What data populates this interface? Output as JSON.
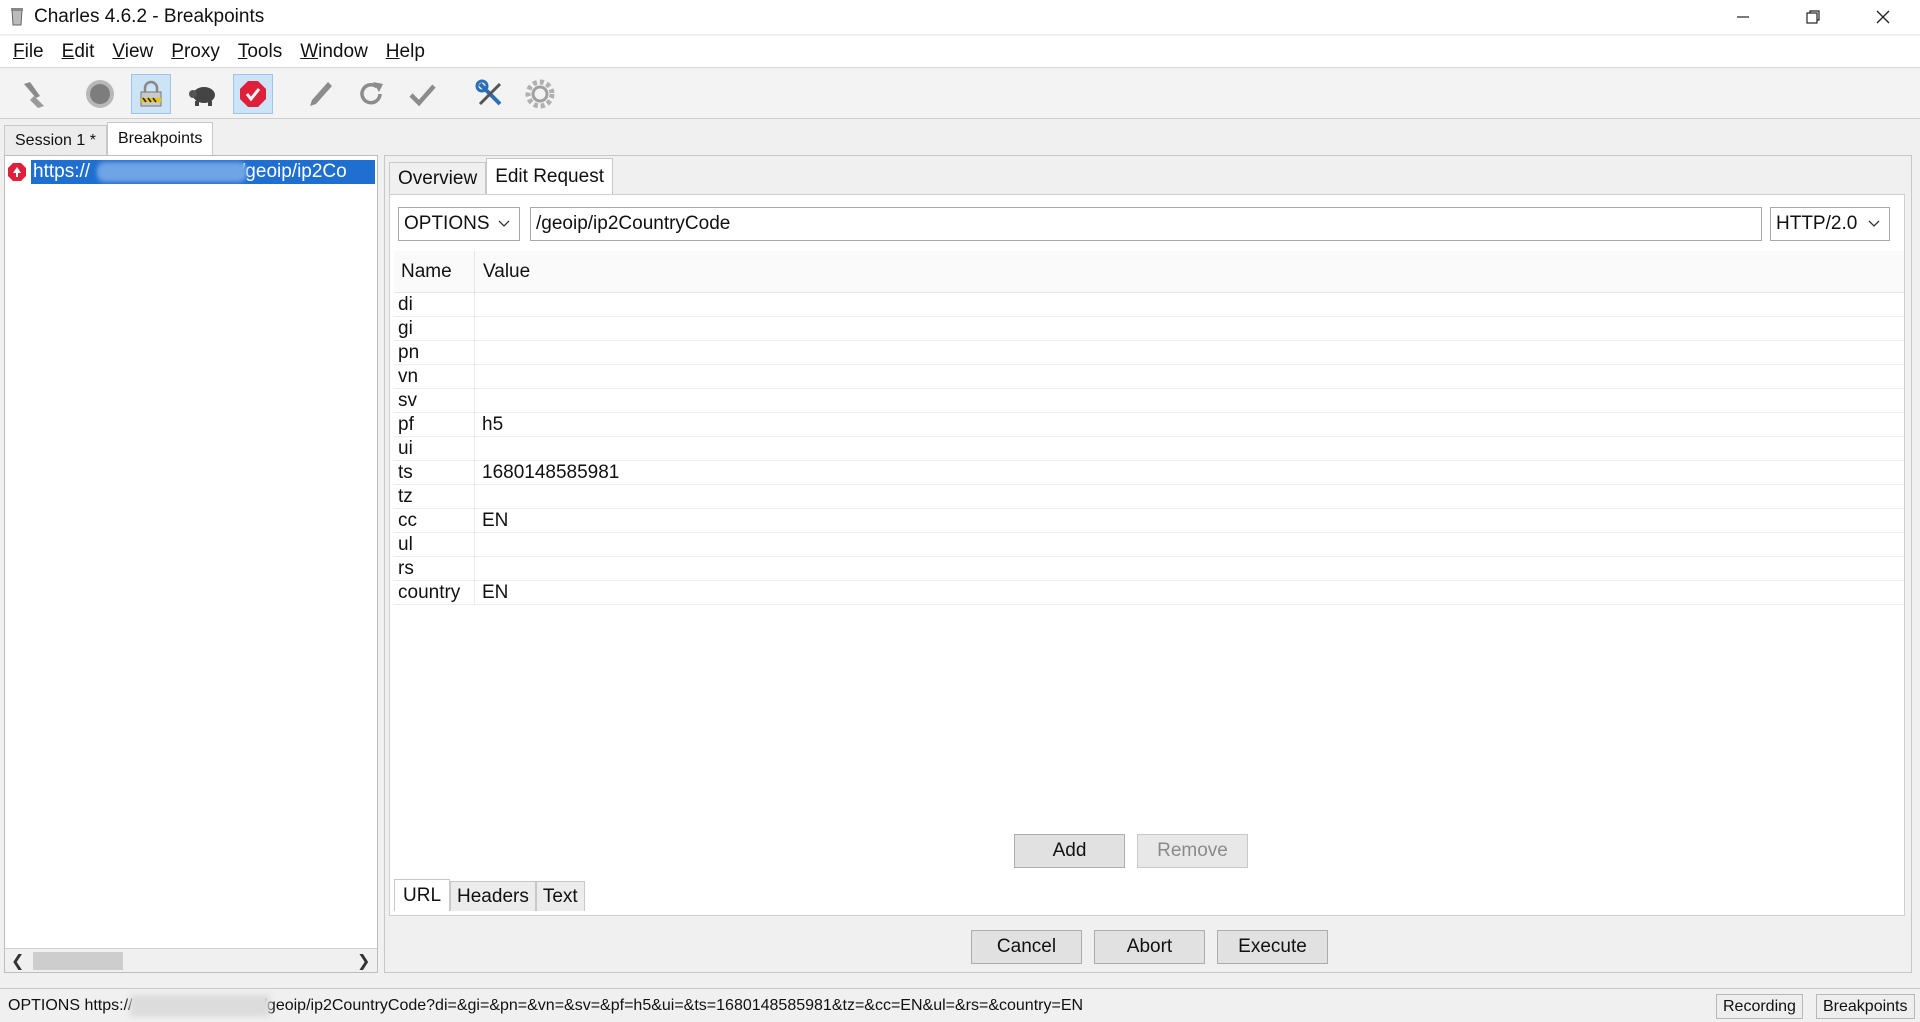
{
  "window": {
    "title": "Charles 4.6.2 - Breakpoints"
  },
  "menu": [
    {
      "label": "File",
      "u": "F",
      "rest": "ile"
    },
    {
      "label": "Edit",
      "u": "E",
      "rest": "dit"
    },
    {
      "label": "View",
      "u": "V",
      "rest": "iew"
    },
    {
      "label": "Proxy",
      "u": "P",
      "rest": "roxy"
    },
    {
      "label": "Tools",
      "u": "T",
      "rest": "ools"
    },
    {
      "label": "Window",
      "u": "W",
      "rest": "indow"
    },
    {
      "label": "Help",
      "u": "H",
      "rest": "elp"
    }
  ],
  "toolbar": {
    "icons": [
      "broom-icon",
      "record-icon",
      "ssl-proxy-icon",
      "throttle-icon",
      "breakpoints-icon",
      "pen-icon",
      "refresh-icon",
      "check-icon",
      "tools-icon",
      "settings-icon"
    ],
    "active": [
      "ssl-proxy-icon",
      "breakpoints-icon"
    ]
  },
  "session_tabs": [
    "Session 1 *",
    "Breakpoints"
  ],
  "tree": {
    "url_prefix": "https://",
    "url_suffix": "/geoip/ip2Co"
  },
  "right_tabs": [
    "Overview",
    "Edit Request"
  ],
  "request": {
    "method": "OPTIONS",
    "path": "/geoip/ip2CountryCode",
    "protocol": "HTTP/2.0"
  },
  "params_table": {
    "headers": [
      "Name",
      "Value"
    ],
    "rows": [
      {
        "name": "di",
        "value": ""
      },
      {
        "name": "gi",
        "value": ""
      },
      {
        "name": "pn",
        "value": ""
      },
      {
        "name": "vn",
        "value": ""
      },
      {
        "name": "sv",
        "value": ""
      },
      {
        "name": "pf",
        "value": "h5"
      },
      {
        "name": "ui",
        "value": ""
      },
      {
        "name": "ts",
        "value": "1680148585981"
      },
      {
        "name": "tz",
        "value": ""
      },
      {
        "name": "cc",
        "value": "EN"
      },
      {
        "name": "ul",
        "value": ""
      },
      {
        "name": "rs",
        "value": ""
      },
      {
        "name": "country",
        "value": "EN"
      }
    ]
  },
  "buttons": {
    "add": "Add",
    "remove": "Remove",
    "cancel": "Cancel",
    "abort": "Abort",
    "execute": "Execute"
  },
  "sub_tabs": [
    "URL",
    "Headers",
    "Text"
  ],
  "status": {
    "text_prefix": "OPTIONS https://",
    "text_suffix": "/geoip/ip2CountryCode?di=&gi=&pn=&vn=&sv=&pf=h5&ui=&ts=1680148585981&tz=&cc=EN&ul=&rs=&country=EN",
    "recording": "Recording",
    "breakpoints": "Breakpoints"
  }
}
